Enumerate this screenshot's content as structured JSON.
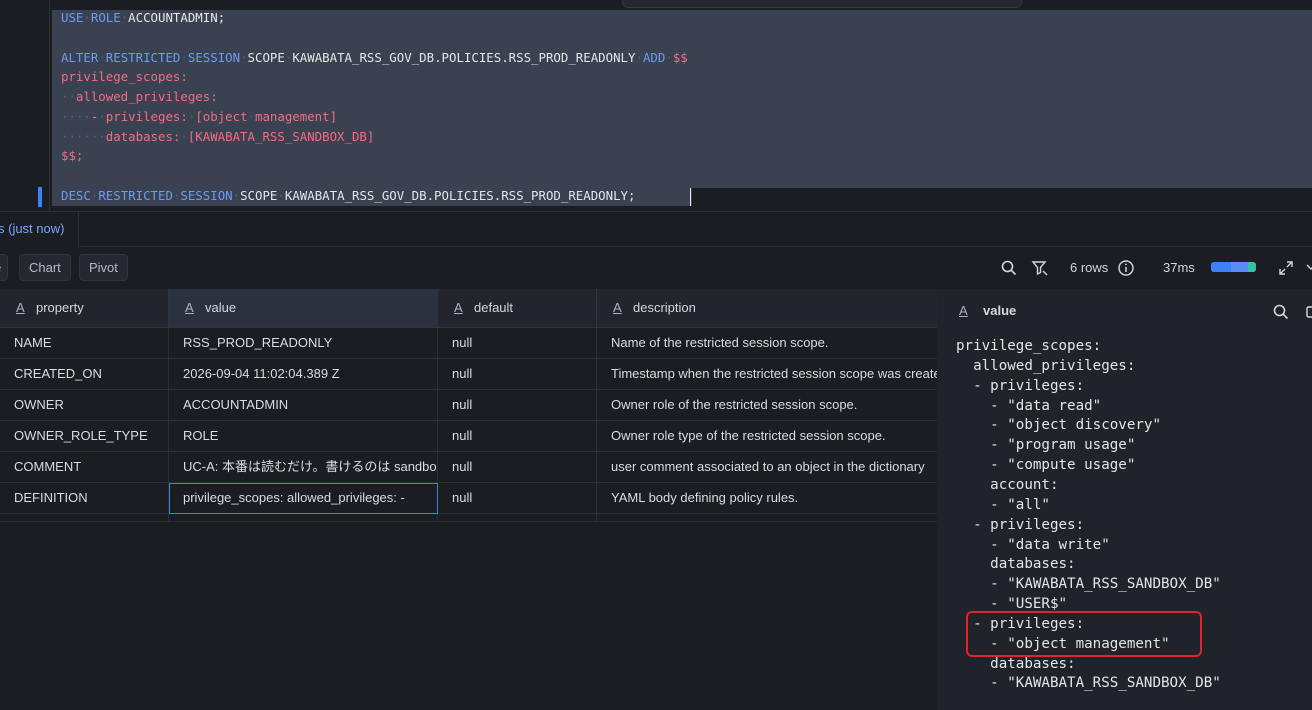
{
  "editor": {
    "lines": [
      [
        {
          "t": "USE",
          "c": "kw"
        },
        {
          "t": "·",
          "c": "ws"
        },
        {
          "t": "ROLE",
          "c": "kw"
        },
        {
          "t": "·",
          "c": "ws"
        },
        {
          "t": "ACCOUNTADMIN;",
          "c": "obj"
        }
      ],
      [],
      [
        {
          "t": "ALTER",
          "c": "kw"
        },
        {
          "t": "·",
          "c": "ws"
        },
        {
          "t": "RESTRICTED",
          "c": "kw"
        },
        {
          "t": "·",
          "c": "ws"
        },
        {
          "t": "SESSION",
          "c": "kw"
        },
        {
          "t": "·",
          "c": "ws"
        },
        {
          "t": "SCOPE",
          "c": "obj"
        },
        {
          "t": "·",
          "c": "ws"
        },
        {
          "t": "KAWABATA_RSS_GOV_DB.POLICIES.RSS_PROD_READONLY",
          "c": "obj"
        },
        {
          "t": "·",
          "c": "ws"
        },
        {
          "t": "ADD",
          "c": "kw"
        },
        {
          "t": "·",
          "c": "ws"
        },
        {
          "t": "$$",
          "c": "str"
        }
      ],
      [
        {
          "t": "privilege_scopes:",
          "c": "str"
        }
      ],
      [
        {
          "t": "··",
          "c": "ws"
        },
        {
          "t": "allowed_privileges:",
          "c": "str"
        }
      ],
      [
        {
          "t": "····",
          "c": "ws"
        },
        {
          "t": "-",
          "c": "str"
        },
        {
          "t": "·",
          "c": "ws"
        },
        {
          "t": "privileges:",
          "c": "str"
        },
        {
          "t": "·",
          "c": "ws"
        },
        {
          "t": "[object",
          "c": "str"
        },
        {
          "t": "·",
          "c": "ws"
        },
        {
          "t": "management]",
          "c": "str"
        }
      ],
      [
        {
          "t": "······",
          "c": "ws"
        },
        {
          "t": "databases:",
          "c": "str"
        },
        {
          "t": "·",
          "c": "ws"
        },
        {
          "t": "[KAWABATA_RSS_SANDBOX_DB]",
          "c": "str"
        }
      ],
      [
        {
          "t": "$$;",
          "c": "str"
        }
      ],
      [],
      [
        {
          "t": "DESC",
          "c": "kw"
        },
        {
          "t": "·",
          "c": "ws"
        },
        {
          "t": "RESTRICTED",
          "c": "kw"
        },
        {
          "t": "·",
          "c": "ws"
        },
        {
          "t": "SESSION",
          "c": "kw"
        },
        {
          "t": "·",
          "c": "ws"
        },
        {
          "t": "SCOPE",
          "c": "obj"
        },
        {
          "t": "·",
          "c": "ws"
        },
        {
          "t": "KAWABATA_RSS_GOV_DB.POLICIES.RSS_PROD_READONLY;",
          "c": "obj"
        }
      ]
    ]
  },
  "results_tab": {
    "label": "s (just now)"
  },
  "toolbar": {
    "table_label": "e",
    "chart_label": "Chart",
    "pivot_label": "Pivot",
    "rows_label": "6 rows",
    "time_label": "37ms"
  },
  "grid": {
    "columns": [
      "property",
      "value",
      "default",
      "description"
    ],
    "rows": [
      [
        "NAME",
        "RSS_PROD_READONLY",
        "null",
        "Name of the restricted session scope."
      ],
      [
        "CREATED_ON",
        "2026-09-04 11:02:04.389 Z",
        "null",
        "Timestamp when the restricted session scope was created."
      ],
      [
        "OWNER",
        "ACCOUNTADMIN",
        "null",
        "Owner role of the restricted session scope."
      ],
      [
        "OWNER_ROLE_TYPE",
        "ROLE",
        "null",
        "Owner role type of the restricted session scope."
      ],
      [
        "COMMENT",
        "UC-A: 本番は読むだけ。書けるのは sandbox",
        "null",
        "user comment associated to an object in the dictionary"
      ],
      [
        "DEFINITION",
        "privilege_scopes:   allowed_privileges:   -",
        "null",
        "YAML body defining policy rules."
      ]
    ]
  },
  "side_panel": {
    "title": "value",
    "yaml": [
      "privilege_scopes:",
      "  allowed_privileges:",
      "  - privileges:",
      "    - \"data read\"",
      "    - \"object discovery\"",
      "    - \"program usage\"",
      "    - \"compute usage\"",
      "    account:",
      "    - \"all\"",
      "  - privileges:",
      "    - \"data write\"",
      "    databases:",
      "    - \"KAWABATA_RSS_SANDBOX_DB\"",
      "    - \"USER$\"",
      "  - privileges:",
      "    - \"object management\"",
      "    databases:",
      "    - \"KAWABATA_RSS_SANDBOX_DB\""
    ]
  },
  "colors": {
    "accent": "#3b82f6",
    "highlight_box": "#e0242f",
    "keyword": "#6b9cf5",
    "string": "#f26d82"
  }
}
